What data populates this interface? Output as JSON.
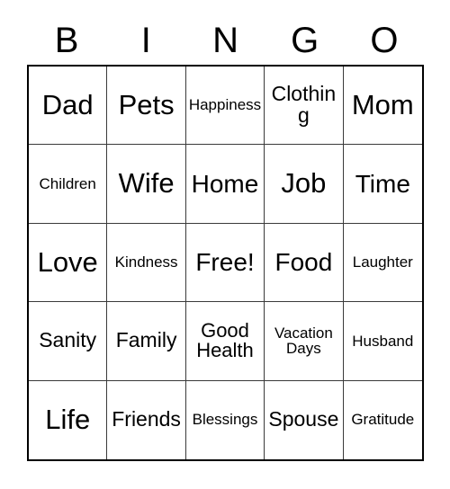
{
  "card": {
    "title": "BINGO",
    "header": {
      "letters": [
        "B",
        "I",
        "N",
        "G",
        "O"
      ]
    },
    "grid": {
      "columns": 5,
      "rows": 5,
      "cells": [
        {
          "text": "Dad",
          "size": "xl",
          "free": false
        },
        {
          "text": "Pets",
          "size": "xl",
          "free": false
        },
        {
          "text": "Happiness",
          "size": "sm",
          "free": false
        },
        {
          "text": "Clothing",
          "size": "md",
          "free": false
        },
        {
          "text": "Mom",
          "size": "xl",
          "free": false
        },
        {
          "text": "Children",
          "size": "sm",
          "free": false
        },
        {
          "text": "Wife",
          "size": "xl",
          "free": false
        },
        {
          "text": "Home",
          "size": "lg",
          "free": false
        },
        {
          "text": "Job",
          "size": "xl",
          "free": false
        },
        {
          "text": "Time",
          "size": "lg",
          "free": false
        },
        {
          "text": "Love",
          "size": "xl",
          "free": false
        },
        {
          "text": "Kindness",
          "size": "sm",
          "free": false
        },
        {
          "text": "Free!",
          "size": "lg",
          "free": true
        },
        {
          "text": "Food",
          "size": "lg",
          "free": false
        },
        {
          "text": "Laughter",
          "size": "sm",
          "free": false
        },
        {
          "text": "Sanity",
          "size": "md",
          "free": false
        },
        {
          "text": "Family",
          "size": "md",
          "free": false
        },
        {
          "text": "Good\nHealth",
          "size": "two",
          "free": false
        },
        {
          "text": "Vacation\nDays",
          "size": "sm",
          "free": false
        },
        {
          "text": "Husband",
          "size": "sm",
          "free": false
        },
        {
          "text": "Life",
          "size": "xl",
          "free": false
        },
        {
          "text": "Friends",
          "size": "md",
          "free": false
        },
        {
          "text": "Blessings",
          "size": "sm",
          "free": false
        },
        {
          "text": "Spouse",
          "size": "md",
          "free": false
        },
        {
          "text": "Gratitude",
          "size": "sm",
          "free": false
        }
      ]
    },
    "colors": {
      "background": "#ffffff",
      "text": "#000000",
      "outer_border": "#000000",
      "grid_line": "#3a3a3a"
    }
  }
}
